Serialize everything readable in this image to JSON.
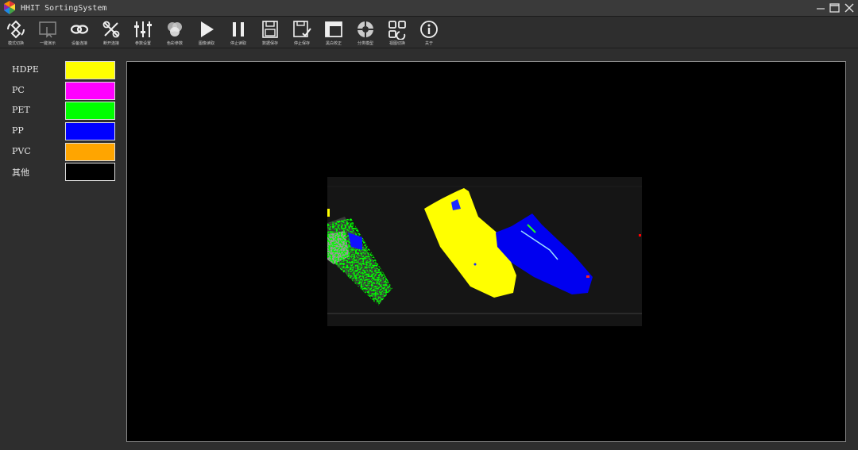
{
  "window": {
    "title": "HHIT SortingSystem",
    "controls": [
      "minimize-icon",
      "maximize-icon",
      "close-icon"
    ]
  },
  "toolbar": {
    "items": [
      {
        "label": "模式切换",
        "icon": "mode-switch-icon"
      },
      {
        "label": "一键演示",
        "icon": "one-click-demo-icon"
      },
      {
        "label": "设备连接",
        "icon": "device-connect-icon"
      },
      {
        "label": "断开连接",
        "icon": "disconnect-icon"
      },
      {
        "label": "参数设置",
        "icon": "sliders-icon"
      },
      {
        "label": "色彩参数",
        "icon": "color-params-icon"
      },
      {
        "label": "图像读取",
        "icon": "play-icon"
      },
      {
        "label": "停止读取",
        "icon": "pause-icon"
      },
      {
        "label": "数据保存",
        "icon": "save-icon"
      },
      {
        "label": "停止保存",
        "icon": "stop-save-icon"
      },
      {
        "label": "黑白校正",
        "icon": "calibration-icon"
      },
      {
        "label": "分类模型",
        "icon": "model-icon"
      },
      {
        "label": "视图切换",
        "icon": "view-switch-icon"
      },
      {
        "label": "关于",
        "icon": "info-icon"
      }
    ]
  },
  "legend": {
    "items": [
      {
        "label": "HDPE",
        "color": "#ffff00"
      },
      {
        "label": "PC",
        "color": "#ff00ff"
      },
      {
        "label": "PET",
        "color": "#00ff00"
      },
      {
        "label": "PP",
        "color": "#0000ff"
      },
      {
        "label": "PVC",
        "color": "#ffa500"
      },
      {
        "label": "其他",
        "color": "#000000"
      }
    ]
  },
  "colors": {
    "background": "#2e2e2e",
    "viewport": "#000000",
    "hdpe": "#ffff00",
    "pet": "#00ff00",
    "pp": "#0000ff"
  }
}
